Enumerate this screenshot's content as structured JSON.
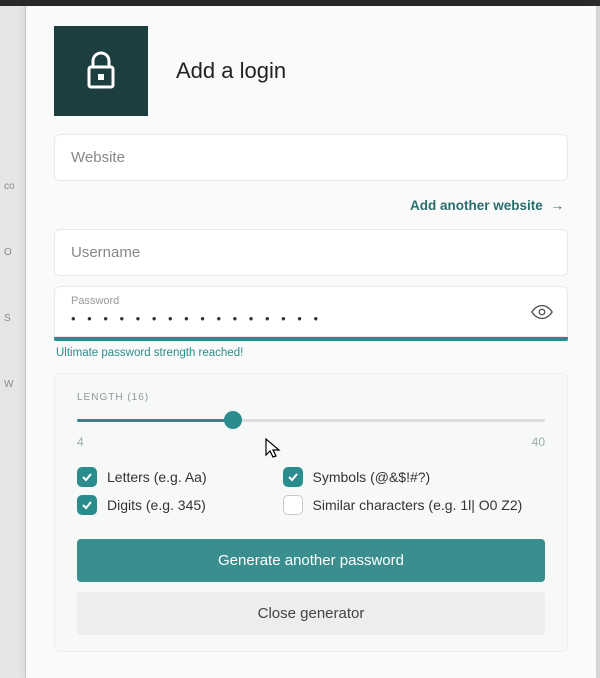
{
  "header": {
    "title": "Add a login"
  },
  "website": {
    "label": "Website",
    "value": ""
  },
  "add_another_link": "Add another website",
  "username": {
    "label": "Username",
    "value": ""
  },
  "password": {
    "label": "Password",
    "masked": "• • • • • • • • • • • • • • • •"
  },
  "strength_message": "Ultimate password strength reached!",
  "generator": {
    "length_label": "LENGTH (16)",
    "length_value": 16,
    "min": 4,
    "max": 40,
    "min_label": "4",
    "max_label": "40",
    "options": {
      "letters": {
        "label": "Letters (e.g. Aa)",
        "checked": true
      },
      "symbols": {
        "label": "Symbols (@&$!#?)",
        "checked": true
      },
      "digits": {
        "label": "Digits (e.g. 345)",
        "checked": true
      },
      "similar": {
        "label": "Similar characters (e.g. 1l| O0 Z2)",
        "checked": false
      }
    },
    "generate_btn": "Generate another password",
    "close_btn": "Close generator"
  },
  "colors": {
    "accent": "#2a8c8c",
    "dark_tile": "#1d3e3e"
  },
  "left_edge_hints": [
    "co",
    "O",
    "S",
    "W"
  ]
}
